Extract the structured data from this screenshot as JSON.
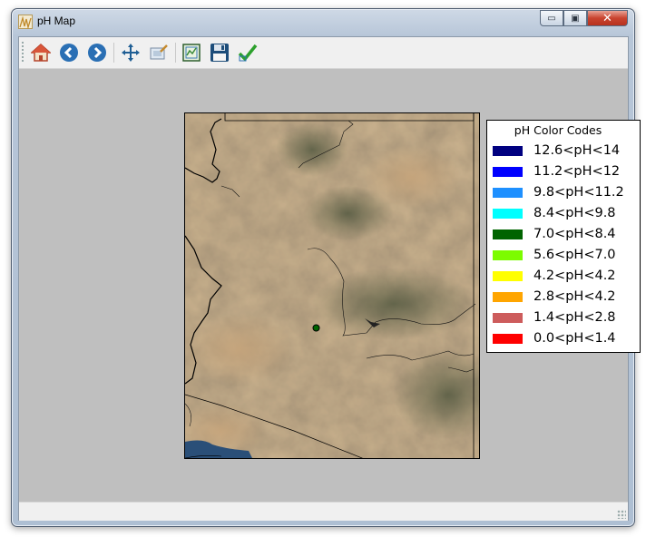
{
  "window": {
    "title": "pH Map"
  },
  "caption_buttons": [
    {
      "name": "minimize",
      "glyph": "▭"
    },
    {
      "name": "maximize",
      "glyph": "▣"
    },
    {
      "name": "close",
      "glyph": "✕"
    }
  ],
  "toolbar": {
    "buttons": [
      {
        "name": "home-button",
        "icon": "home-icon"
      },
      {
        "name": "back-button",
        "icon": "arrow-left-icon"
      },
      {
        "name": "forward-button",
        "icon": "arrow-right-icon"
      },
      {
        "name": "pan-button",
        "icon": "move-arrows-icon"
      },
      {
        "name": "zoom-button",
        "icon": "zoom-rect-icon"
      },
      {
        "name": "configure-subplots-button",
        "icon": "subplots-icon"
      },
      {
        "name": "save-button",
        "icon": "floppy-disk-icon"
      },
      {
        "name": "edit-parameters-button",
        "icon": "checkmark-icon"
      }
    ]
  },
  "legend": {
    "title": "pH Color Codes",
    "items": [
      {
        "label": "12.6<pH<14",
        "color": "#000080"
      },
      {
        "label": "11.2<pH<12",
        "color": "#0000ff"
      },
      {
        "label": "9.8<pH<11.2",
        "color": "#1e90ff"
      },
      {
        "label": "8.4<pH<9.8",
        "color": "#00ffff"
      },
      {
        "label": "7.0<pH<8.4",
        "color": "#006400"
      },
      {
        "label": "5.6<pH<7.0",
        "color": "#7cfc00"
      },
      {
        "label": "4.2<pH<4.2",
        "color": "#ffff00"
      },
      {
        "label": "2.8<pH<4.2",
        "color": "#ffa500"
      },
      {
        "label": "1.4<pH<2.8",
        "color": "#cd5c5c"
      },
      {
        "label": "0.0<pH<1.4",
        "color": "#ff0000"
      }
    ]
  },
  "map": {
    "sample_point_color": "#006400"
  }
}
